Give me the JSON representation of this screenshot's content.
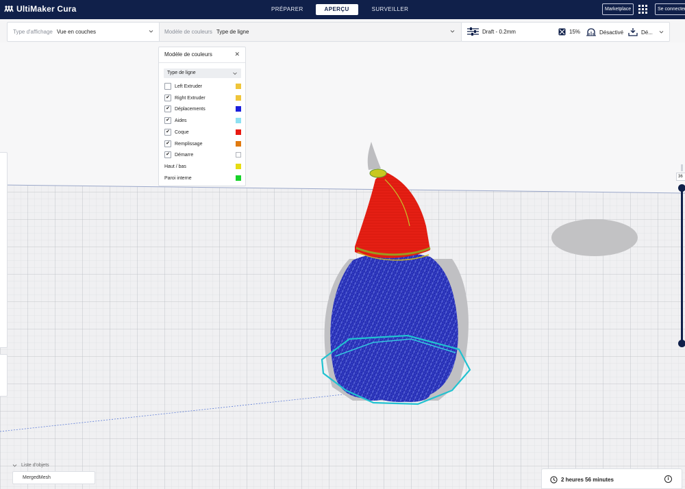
{
  "app": {
    "name": "UltiMaker Cura",
    "tabs": [
      "PRÉPARER",
      "APERÇU",
      "SURVEILLER"
    ],
    "active_tab": "APERÇU",
    "marketplace_label": "Marketplace",
    "signin_label": "Se connecter"
  },
  "viewbar": {
    "view_type_label": "Type d'affichage",
    "view_type_value": "Vue en couches",
    "color_model_label": "Modèle de couleurs",
    "color_model_value": "Type de ligne"
  },
  "printbar": {
    "profile": "Draft - 0.2mm",
    "infill": "15%",
    "support": "Désactivé",
    "adhesion_truncated": "Dé..."
  },
  "color_panel": {
    "title": "Modèle de couleurs",
    "close_glyph": "✕",
    "select_value": "Type de ligne",
    "items": [
      {
        "label": "Left Extruder",
        "checked": false,
        "has_checkbox": true,
        "color": "#efc53a"
      },
      {
        "label": "Right Extruder",
        "checked": true,
        "has_checkbox": true,
        "color": "#efc53a"
      },
      {
        "label": "Déplacements",
        "checked": true,
        "has_checkbox": true,
        "color": "#1b1fdc"
      },
      {
        "label": "Aides",
        "checked": true,
        "has_checkbox": true,
        "color": "#8ee0f2"
      },
      {
        "label": "Coque",
        "checked": true,
        "has_checkbox": true,
        "color": "#e81a12"
      },
      {
        "label": "Remplissage",
        "checked": true,
        "has_checkbox": true,
        "color": "#e07a10"
      },
      {
        "label": "Démarre",
        "checked": true,
        "has_checkbox": true,
        "color": "#ffffff"
      },
      {
        "label": "Haut / bas",
        "checked": false,
        "has_checkbox": false,
        "color": "#e6dc12"
      },
      {
        "label": "Paroi interne",
        "checked": false,
        "has_checkbox": false,
        "color": "#18d22a"
      }
    ],
    "check_glyph": "✔"
  },
  "layer_slider": {
    "value_truncated": "36"
  },
  "object_list": {
    "header": "Liste d'objets",
    "items": [
      "MergedMesh"
    ]
  },
  "print_info": {
    "time": "2 heures 56 minutes",
    "info_glyph": "i"
  },
  "icons": [
    "logo-icon",
    "chevron-down-icon",
    "settings-sliders-icon",
    "infill-icon",
    "support-icon",
    "adhesion-icon",
    "apps-grid-icon",
    "clock-icon",
    "info-icon",
    "close-icon",
    "checkbox-icon"
  ]
}
